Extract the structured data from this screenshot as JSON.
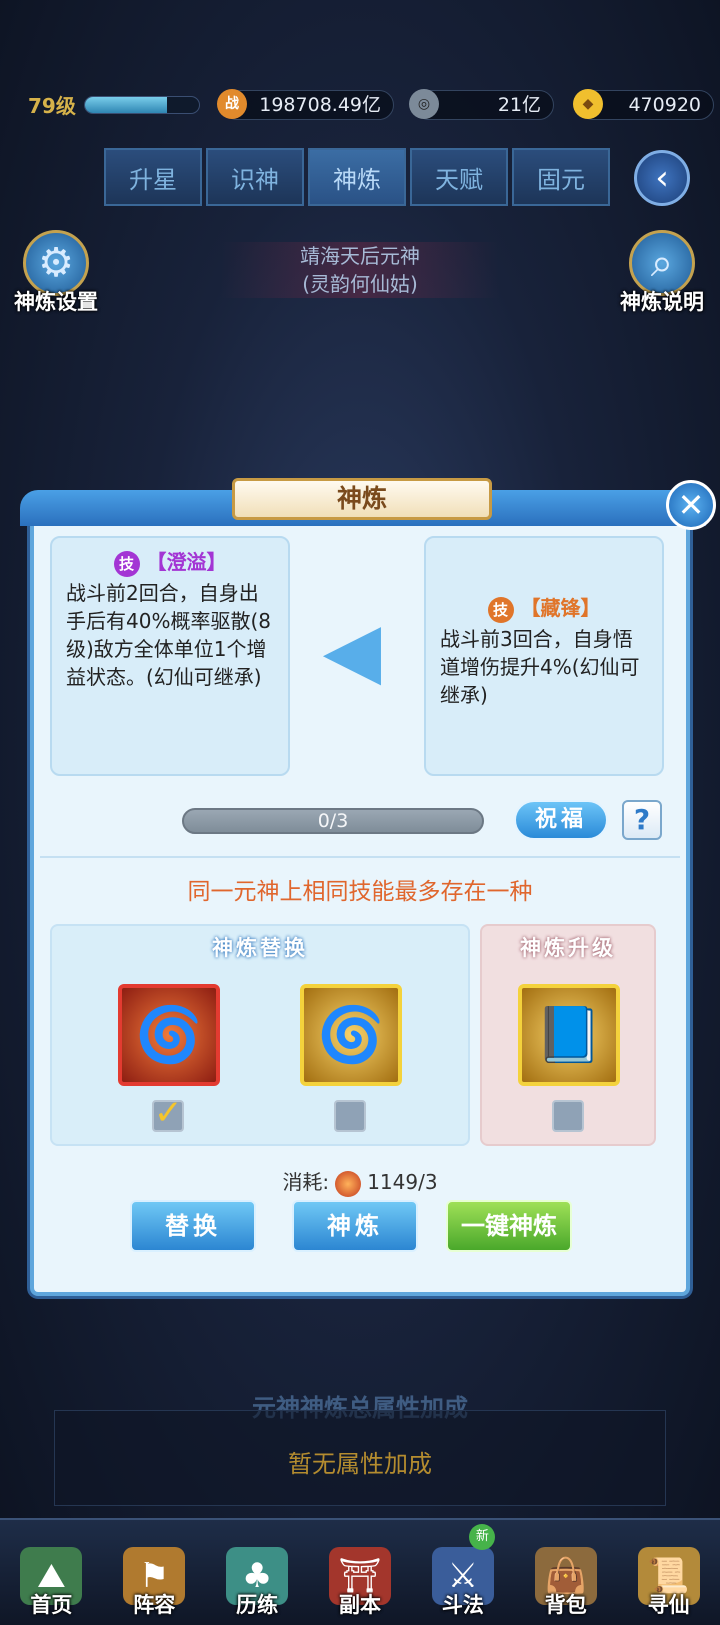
{
  "top_bar": {
    "level": "79级",
    "xp_progress": 0.72,
    "combat_power": "198708.49亿",
    "coins": "21亿",
    "gold": "470920",
    "combat_icon_text": "战"
  },
  "tabs": [
    {
      "label": "升星"
    },
    {
      "label": "识神"
    },
    {
      "label": "神炼"
    },
    {
      "label": "天赋"
    },
    {
      "label": "固元"
    }
  ],
  "active_tab": "神炼",
  "side": {
    "settings_label": "神炼设置",
    "help_label": "神炼说明"
  },
  "hero": {
    "name": "靖海天后元神",
    "subtitle": "(灵韵何仙姑)"
  },
  "dialog": {
    "title": "神炼",
    "left_skill": {
      "badge": "技",
      "name": "【澄溢】",
      "desc": "战斗前2回合，自身出手后有40%概率驱散(8级)敌方全体单位1个增益状态。(幻仙可继承)"
    },
    "right_skill": {
      "badge": "技",
      "name": "【藏锋】",
      "desc": "战斗前3回合，自身悟道增伤提升4%(幻仙可继承)"
    },
    "progress_text": "0/3",
    "progress_value": 0,
    "bless_label": "祝福",
    "help_label": "?",
    "rule_text": "同一元神上相同技能最多存在一种",
    "replace_panel_title": "神炼替换",
    "upgrade_panel_title": "神炼升级",
    "cost_label": "消耗:",
    "cost_value": "1149/3",
    "buttons": {
      "replace": "替换",
      "refine": "神炼",
      "one_click": "一键神炼"
    }
  },
  "bonus": {
    "title": "元神神炼总属性加成",
    "text": "暂无属性加成"
  },
  "bottom_nav": [
    {
      "label": "首页"
    },
    {
      "label": "阵容"
    },
    {
      "label": "历练"
    },
    {
      "label": "副本"
    },
    {
      "label": "斗法",
      "badge": "新"
    },
    {
      "label": "背包"
    },
    {
      "label": "寻仙"
    }
  ],
  "colors": {
    "accent_blue": "#2a8ad8",
    "rule_orange": "#e0662d",
    "skill_left_name": "#a335d4",
    "skill_right_name": "#e0752a",
    "green_button": "#4aa82b"
  }
}
